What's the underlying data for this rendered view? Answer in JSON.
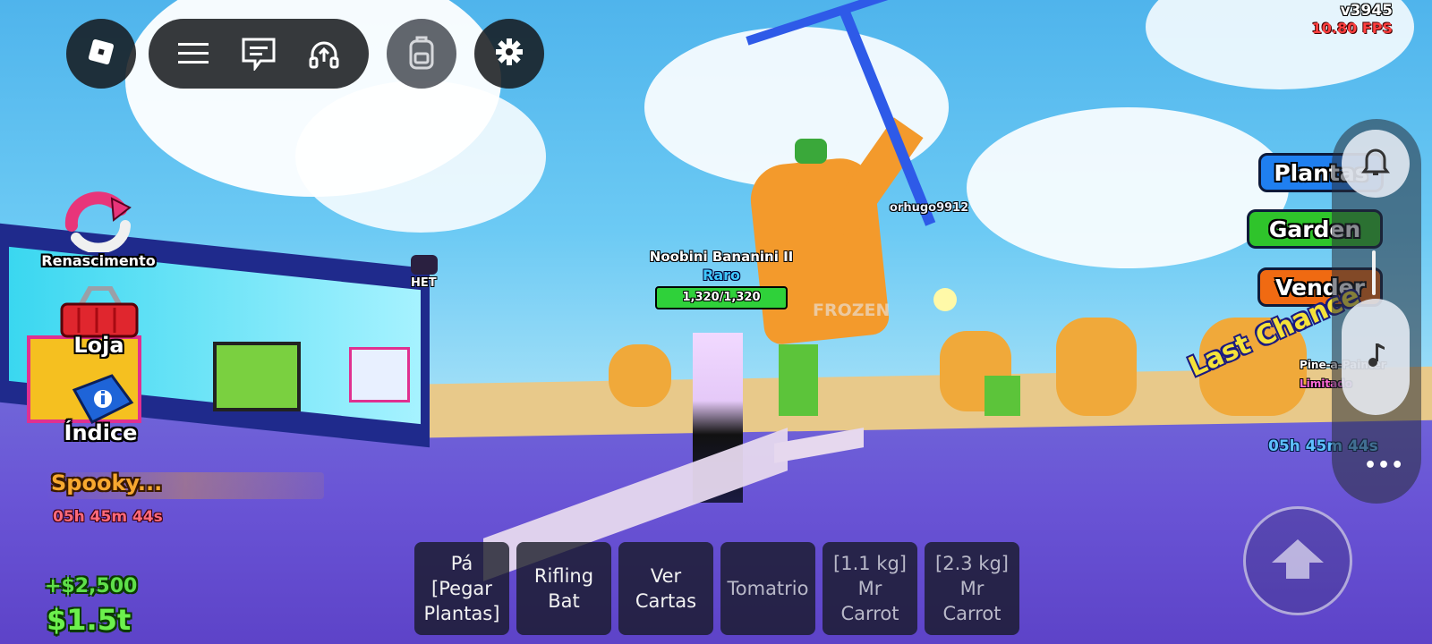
{
  "topbar": {
    "roblox_icon": "roblox-logo-icon",
    "menu_icon": "hamburger-menu-icon",
    "chat_icon": "chat-icon",
    "voice_icon": "voice-chat-icon",
    "backpack_icon": "backpack-icon",
    "settings_icon": "gear-icon"
  },
  "version": {
    "version": "v3945",
    "fps": "10.80 FPS"
  },
  "left_menu": {
    "rebirth": "Renascimento",
    "shop": "Loja",
    "index": "Índice"
  },
  "event": {
    "name": "Spooky...",
    "timer": "05h 45m 44s"
  },
  "money": {
    "gain": "+$2,500",
    "total": "$1.5t"
  },
  "world": {
    "npc_tag": "HET",
    "boss_tag": "frozen",
    "other_player": "orhugo9912",
    "other_plant_name": "Pine-a-Painter",
    "other_plant_rarity": "Limitado"
  },
  "player_tag": {
    "name": "Noobini Bananini II",
    "rarity": "Raro",
    "hp_text": "1,320/1,320",
    "hp_current": 1320,
    "hp_max": 1320
  },
  "right_menu": {
    "plants": "Plantas",
    "garden": "Garden",
    "sell": "Vender",
    "notification_icon": "bell-icon",
    "music_icon": "music-note-icon",
    "more_icon": "more-dots-icon",
    "last_chance": "Last Chance",
    "timer": "05h 45m 44s",
    "jump_icon": "jump-arrow-icon",
    "dots": "•••"
  },
  "hotbar": [
    {
      "label": "Pá\n[Pegar\nPlantas]"
    },
    {
      "label": "Rifling\nBat"
    },
    {
      "label": "Ver\nCartas"
    },
    {
      "label": "Tomatrio"
    },
    {
      "label": "[1.1 kg]\nMr\nCarrot"
    },
    {
      "label": "[2.3 kg]\nMr\nCarrot"
    }
  ],
  "colors": {
    "plants_btn": "#1f7ff0",
    "garden_btn": "#2fc42b",
    "sell_btn": "#f06a12",
    "money_green": "#6cf04d",
    "hp_green": "#2fd13a"
  }
}
